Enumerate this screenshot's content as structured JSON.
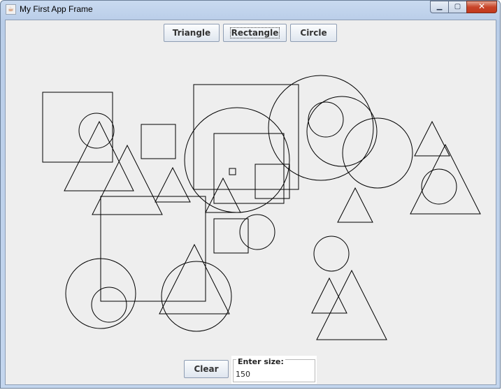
{
  "window": {
    "title": "My First App Frame",
    "minimize_glyph": "▁",
    "maximize_glyph": "▢",
    "close_glyph": "✕"
  },
  "toolbar": {
    "triangle_label": "Triangle",
    "rectangle_label": "Rectangle",
    "circle_label": "Circle"
  },
  "footer": {
    "clear_label": "Clear",
    "size_label": "Enter size:",
    "size_value": "150"
  }
}
